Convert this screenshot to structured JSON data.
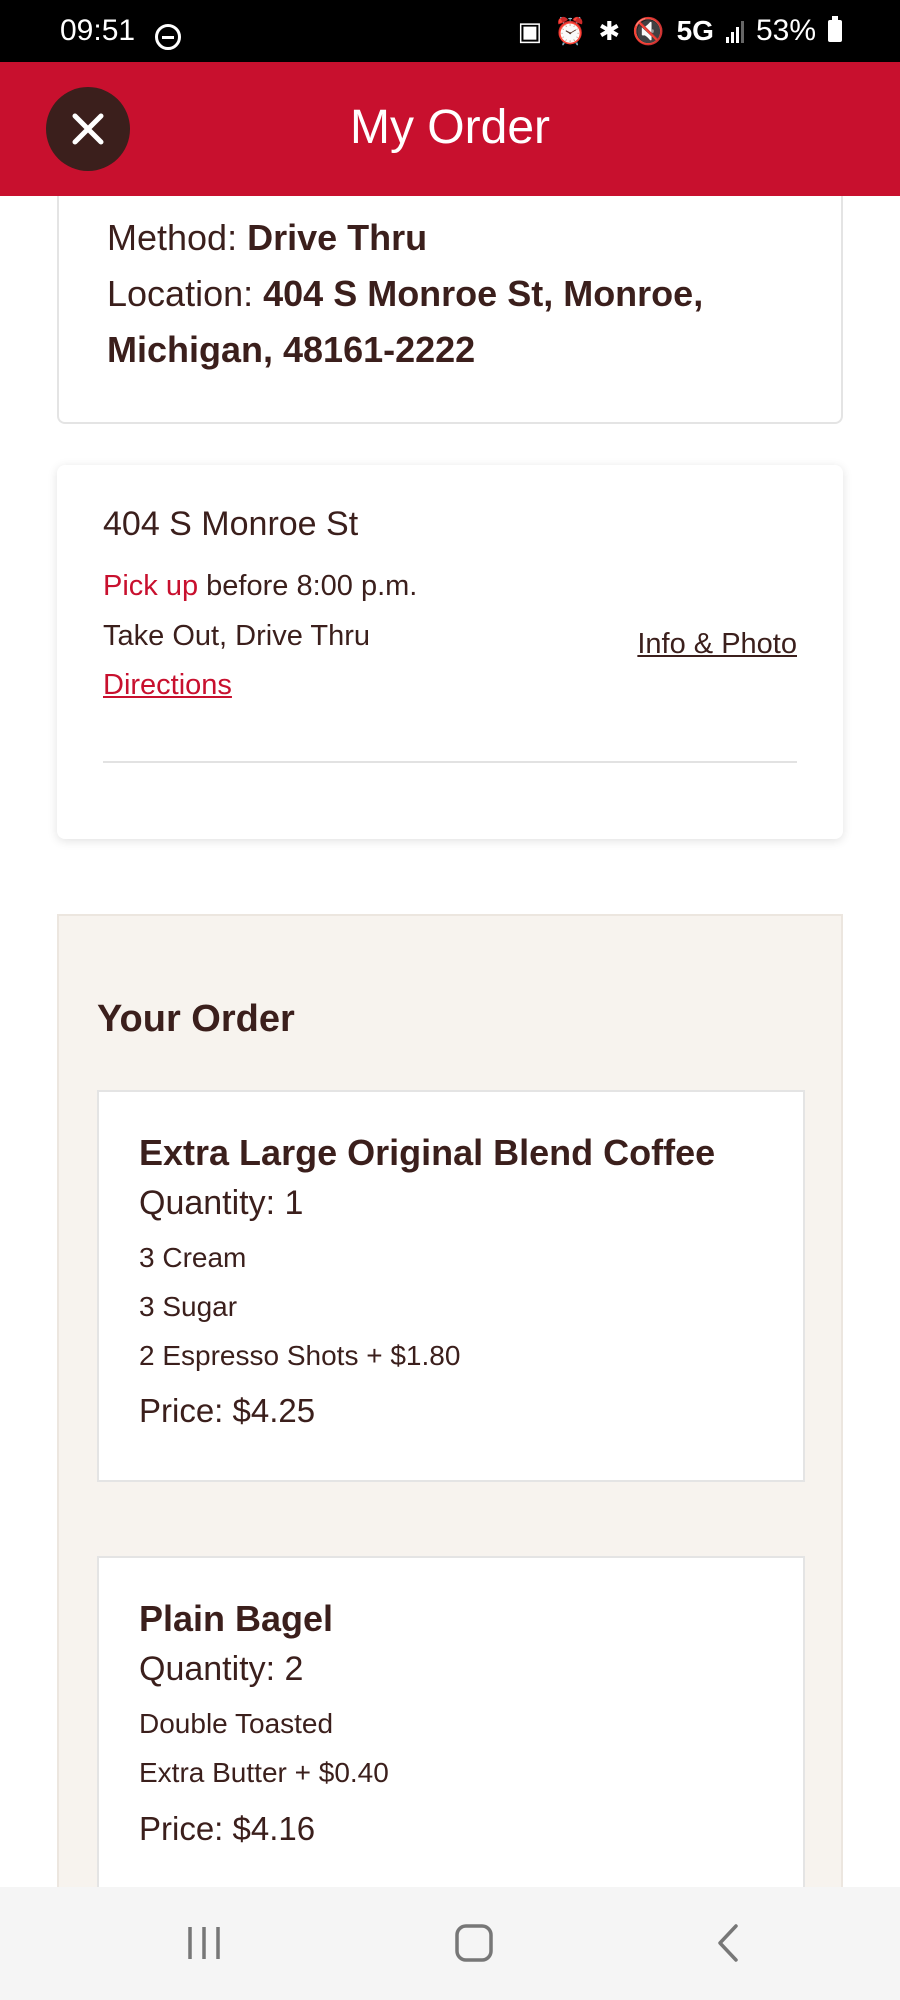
{
  "status_bar": {
    "time": "09:51",
    "network": "5G",
    "battery": "53%",
    "icons": [
      "do-not-disturb-icon",
      "notification-icon",
      "alarm-icon",
      "bluetooth-icon",
      "mute-icon",
      "signal-icon",
      "battery-icon"
    ]
  },
  "header": {
    "title": "My Order",
    "close_icon": "close-icon",
    "accent_color": "#c8102e"
  },
  "order_method": {
    "method_label": "Method:",
    "method_value": "Drive Thru",
    "location_label": "Location:",
    "location_value_line1": "404 S Monroe St, Monroe,",
    "location_value_line2": "Michigan, 48161-2222"
  },
  "store": {
    "name": "404 S Monroe St",
    "pickup_label": "Pick up",
    "pickup_time": "before 8:00 p.m.",
    "services": "Take Out, Drive Thru",
    "directions_link": "Directions",
    "info_link": "Info & Photo"
  },
  "your_order": {
    "heading": "Your Order",
    "items": [
      {
        "name": "Extra Large Original Blend Coffee",
        "quantity": "Quantity: 1",
        "modifiers": [
          "3 Cream",
          "3 Sugar",
          "2 Espresso Shots + $1.80"
        ],
        "price": "Price: $4.25"
      },
      {
        "name": "Plain Bagel",
        "quantity": "Quantity: 2",
        "modifiers": [
          "Double Toasted",
          "Extra Butter + $0.40"
        ],
        "price": "Price: $4.16"
      }
    ]
  },
  "nav_bar": {
    "icons": [
      "recent-apps-icon",
      "home-icon",
      "back-icon"
    ]
  }
}
